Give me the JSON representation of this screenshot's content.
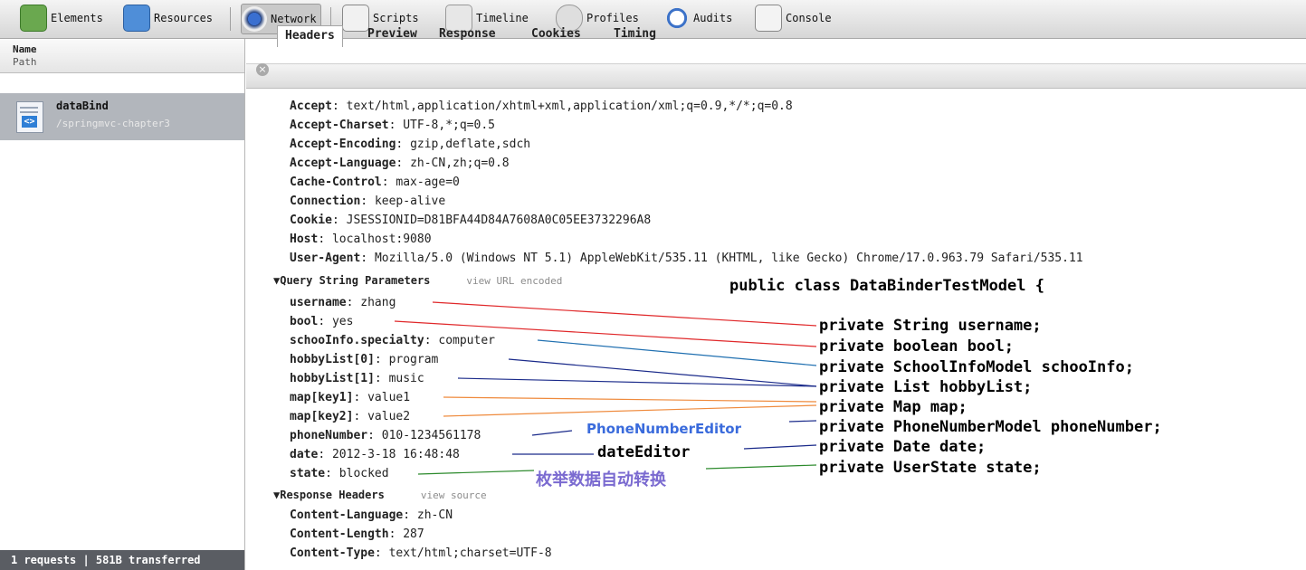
{
  "toolbar": {
    "tabs": [
      {
        "label": "Elements",
        "icon": "elements-icon"
      },
      {
        "label": "Resources",
        "icon": "resources-icon"
      },
      {
        "label": "Network",
        "icon": "network-icon"
      },
      {
        "label": "Scripts",
        "icon": "scripts-icon"
      },
      {
        "label": "Timeline",
        "icon": "timeline-icon"
      },
      {
        "label": "Profiles",
        "icon": "profiles-icon"
      },
      {
        "label": "Audits",
        "icon": "audits-icon"
      },
      {
        "label": "Console",
        "icon": "console-icon"
      }
    ],
    "active": "Network"
  },
  "left": {
    "header_name": "Name",
    "header_path": "Path",
    "request_name": "dataBind",
    "request_path": "/springmvc-chapter3",
    "footer": "1 requests  |  581B transferred"
  },
  "detail_tabs": [
    "Headers",
    "Preview",
    "Response",
    "Cookies",
    "Timing"
  ],
  "request_headers": [
    {
      "k": "Accept",
      "v": "text/html,application/xhtml+xml,application/xml;q=0.9,*/*;q=0.8"
    },
    {
      "k": "Accept-Charset",
      "v": "UTF-8,*;q=0.5"
    },
    {
      "k": "Accept-Encoding",
      "v": "gzip,deflate,sdch"
    },
    {
      "k": "Accept-Language",
      "v": "zh-CN,zh;q=0.8"
    },
    {
      "k": "Cache-Control",
      "v": "max-age=0"
    },
    {
      "k": "Connection",
      "v": "keep-alive"
    },
    {
      "k": "Cookie",
      "v": "JSESSIONID=D81BFA44D84A7608A0C05EE3732296A8"
    },
    {
      "k": "Host",
      "v": "localhost:9080"
    },
    {
      "k": "User-Agent",
      "v": "Mozilla/5.0 (Windows NT 5.1) AppleWebKit/535.11 (KHTML, like Gecko) Chrome/17.0.963.79 Safari/535.11"
    }
  ],
  "query_section": {
    "title": "Query String Parameters",
    "toggle": "view URL encoded"
  },
  "query_params": [
    {
      "k": "username",
      "v": "zhang"
    },
    {
      "k": "bool",
      "v": "yes"
    },
    {
      "k": "schooInfo.specialty",
      "v": "computer"
    },
    {
      "k": "hobbyList[0]",
      "v": "program"
    },
    {
      "k": "hobbyList[1]",
      "v": "music"
    },
    {
      "k": "map[key1]",
      "v": "value1"
    },
    {
      "k": "map[key2]",
      "v": "value2"
    },
    {
      "k": "phoneNumber",
      "v": "010-1234561178"
    },
    {
      "k": "date",
      "v": "2012-3-18 16:48:48"
    },
    {
      "k": "state",
      "v": "blocked"
    }
  ],
  "response_section": {
    "title": "Response Headers",
    "toggle": "view source"
  },
  "response_headers": [
    {
      "k": "Content-Language",
      "v": "zh-CN"
    },
    {
      "k": "Content-Length",
      "v": "287"
    },
    {
      "k": "Content-Type",
      "v": "text/html;charset=UTF-8"
    }
  ],
  "model": {
    "class_decl": "public class DataBinderTestModel {",
    "fields": [
      "private String username;",
      "private boolean bool;",
      "private SchoolInfoModel schooInfo;",
      "private List hobbyList;",
      "private Map map;",
      "private PhoneNumberModel phoneNumber;",
      "private Date date;",
      "private UserState state;"
    ]
  },
  "annotations": {
    "phone_editor": "PhoneNumberEditor",
    "date_editor": "dateEditor",
    "enum_convert": "枚举数据自动转换"
  },
  "colors": {
    "red": "#e0282a",
    "blue": "#1f6fb0",
    "dark_blue": "#1a2a8a",
    "orange": "#ef8a3c",
    "green": "#2c8a2c",
    "annotation_blue": "#3a6bdc",
    "annotation_purple": "#7a6ad0"
  }
}
